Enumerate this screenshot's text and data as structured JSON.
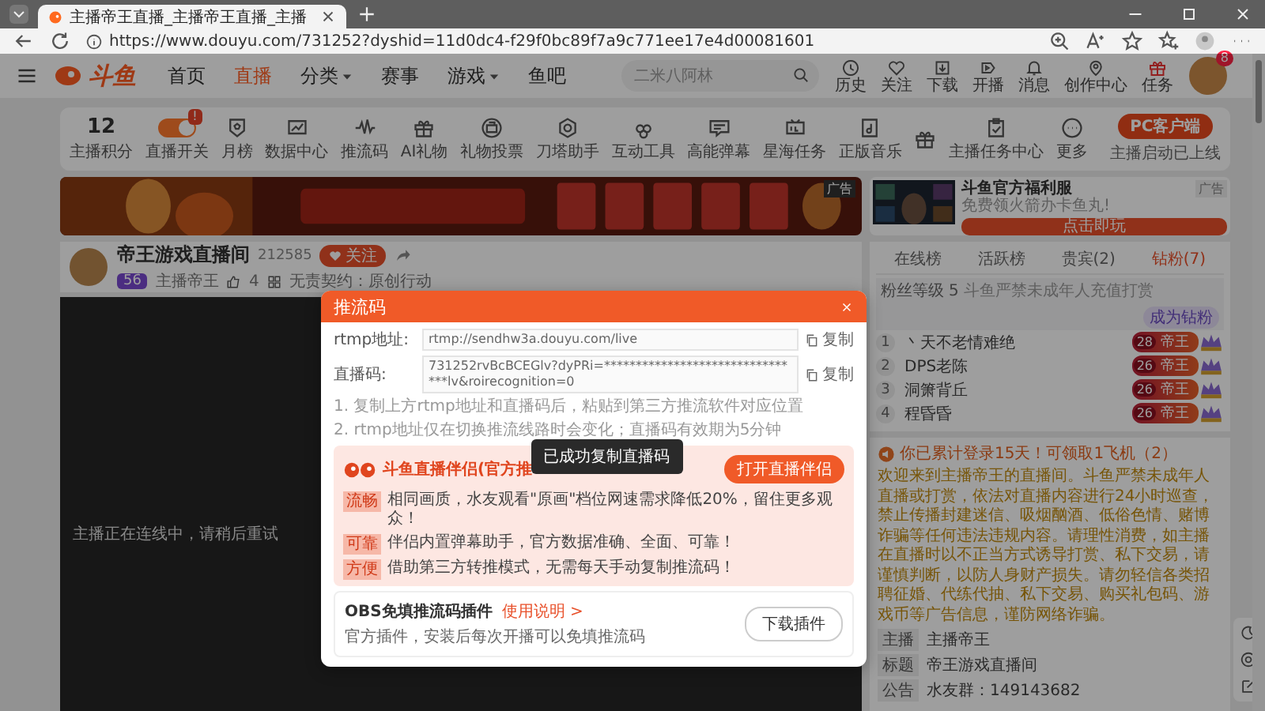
{
  "browser": {
    "tab_title": "主播帝王直播_主播帝王直播_主播",
    "url": "https://www.douyu.com/731252?dyshid=11d0dc4-f29f0bc89f7a9c771ee17e4d00081601"
  },
  "header": {
    "logo": "斗鱼",
    "nav": [
      {
        "label": "首页",
        "selected": false,
        "dropdown": false
      },
      {
        "label": "直播",
        "selected": true,
        "dropdown": false
      },
      {
        "label": "分类",
        "selected": false,
        "dropdown": true
      },
      {
        "label": "赛事",
        "selected": false,
        "dropdown": false
      },
      {
        "label": "游戏",
        "selected": false,
        "dropdown": true
      },
      {
        "label": "鱼吧",
        "selected": false,
        "dropdown": false
      }
    ],
    "search": {
      "placeholder": "二米八阿林"
    },
    "actions": [
      "历史",
      "关注",
      "下载",
      "开播",
      "消息",
      "创作中心",
      "任务"
    ],
    "avatar_badge": "8"
  },
  "toolbar": {
    "items": [
      {
        "kind": "score",
        "value": "12",
        "label": "主播积分"
      },
      {
        "kind": "toggle",
        "label": "直播开关",
        "on": true,
        "badge": "!"
      },
      {
        "kind": "icon",
        "label": "月榜"
      },
      {
        "kind": "icon",
        "label": "数据中心"
      },
      {
        "kind": "icon",
        "label": "推流码"
      },
      {
        "kind": "icon",
        "label": "AI礼物"
      },
      {
        "kind": "icon",
        "label": "礼物投票"
      },
      {
        "kind": "icon",
        "label": "刀塔助手"
      },
      {
        "kind": "icon",
        "label": "互动工具"
      },
      {
        "kind": "icon",
        "label": "高能弹幕"
      },
      {
        "kind": "icon",
        "label": "星海任务"
      },
      {
        "kind": "icon",
        "label": "正版音乐"
      },
      {
        "kind": "icon"
      },
      {
        "kind": "icon",
        "label": "主播任务中心"
      },
      {
        "kind": "icon",
        "label": "更多"
      }
    ],
    "client_button": "PC客户端",
    "client_note": "主播启动已上线"
  },
  "ads": {
    "banner_label": "广告",
    "side": {
      "title": "斗鱼官方福利服",
      "subtitle": "免费领火箭办卡鱼丸!",
      "button": "点击即玩",
      "label": "广告"
    }
  },
  "room": {
    "title": "帝王游戏直播间",
    "room_id": "212585",
    "follow": "关注",
    "level": "56",
    "host": "主播帝王",
    "likes": "4",
    "contract": "无责契约：原创行动",
    "video_notice": "主播正在连线中，请稍后重试"
  },
  "ranking": {
    "tabs": [
      {
        "label": "在线榜",
        "selected": false
      },
      {
        "label": "活跃榜",
        "selected": false
      },
      {
        "label": "贵宾(2)",
        "selected": false
      },
      {
        "label": "钻粉(7)",
        "selected": true
      }
    ],
    "fan_level_label": "粉丝等级",
    "fan_level": "5",
    "fan_notice": "斗鱼严禁未成年人充值打赏",
    "join_button": "成为钻粉",
    "rows": [
      {
        "rank": "1",
        "name": "丶天不老情难绝",
        "badge_level": "28",
        "badge": "帝王"
      },
      {
        "rank": "2",
        "name": "DPS老陈",
        "badge_level": "26",
        "badge": "帝王"
      },
      {
        "rank": "3",
        "name": "洞箫背丘",
        "badge_level": "26",
        "badge": "帝王"
      },
      {
        "rank": "4",
        "name": "程昏昏",
        "badge_level": "26",
        "badge": "帝王"
      }
    ]
  },
  "chat": {
    "login_notice": "你已累计登录15天！可领取1飞机（2）",
    "welcome": "欢迎来到主播帝王的直播间。斗鱼严禁未成年人直播或打赏，依法对直播内容进行24小时巡查，禁止传播封建迷信、吸烟酗酒、低俗色情、赌博诈骗等任何违法违规内容。请理性消费，如主播在直播时以不正当方式诱导打赏、私下交易，请谨慎判断，以防人身财产损失。请勿轻信各类招聘征婚、代练代抽、私下交易、购买礼包码、游戏币等广告信息，谨防网络诈骗。",
    "info": [
      {
        "tag": "主播",
        "text": "主播帝王"
      },
      {
        "tag": "标题",
        "text": "帝王游戏直播间"
      },
      {
        "tag": "公告",
        "text": "水友群：149143682"
      }
    ]
  },
  "dialog": {
    "title": "推流码",
    "fields": [
      {
        "label": "rtmp地址:",
        "value": "rtmp://sendhw3a.douyu.com/live",
        "copy": "复制"
      },
      {
        "label": "直播码:",
        "value": "731252rvBcBCEGlv?dyPRi=********************************lv&roirecognition=0",
        "copy": "复制"
      }
    ],
    "steps": [
      "1. 复制上方rtmp地址和直播码后，粘贴到第三方推流软件对应位置",
      "2. rtmp地址仅在切换推流线路时会变化；直播码有效期为5分钟"
    ],
    "promo": {
      "title": "斗鱼直播伴侣(官方推",
      "button": "打开直播伴侣",
      "features": [
        {
          "tag": "流畅",
          "text": "相同画质，水友观看\"原画\"档位网速需求降低20%，留住更多观众！"
        },
        {
          "tag": "可靠",
          "text": "伴侣内置弹幕助手，官方数据准确、全面、可靠！"
        },
        {
          "tag": "方便",
          "text": "借助第三方转推模式，无需每天手动复制推流码！"
        }
      ]
    },
    "obs": {
      "title": "OBS免填推流码插件",
      "link": "使用说明 >",
      "text": "官方插件，安装后每次开播可以免填推流码",
      "button": "下载插件"
    },
    "toast": "已成功复制直播码"
  }
}
